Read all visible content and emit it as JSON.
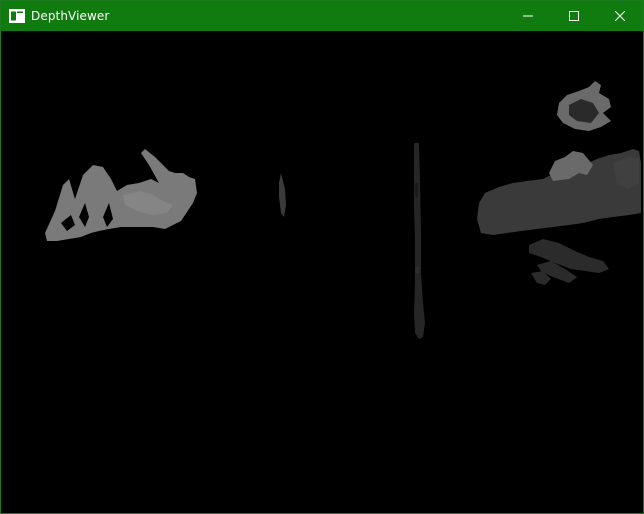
{
  "window": {
    "title": "DepthViewer",
    "app_icon": "window-app-icon",
    "controls": {
      "minimize_icon": "minimize-icon",
      "maximize_icon": "maximize-icon",
      "close_icon": "close-icon"
    },
    "titlebar_color": "#107c10"
  },
  "depth_view": {
    "background": "#000000",
    "blob_colors": {
      "near": "#808080",
      "mid": "#5a5a5a",
      "far": "#3a3a3a",
      "very_far": "#262626"
    }
  }
}
